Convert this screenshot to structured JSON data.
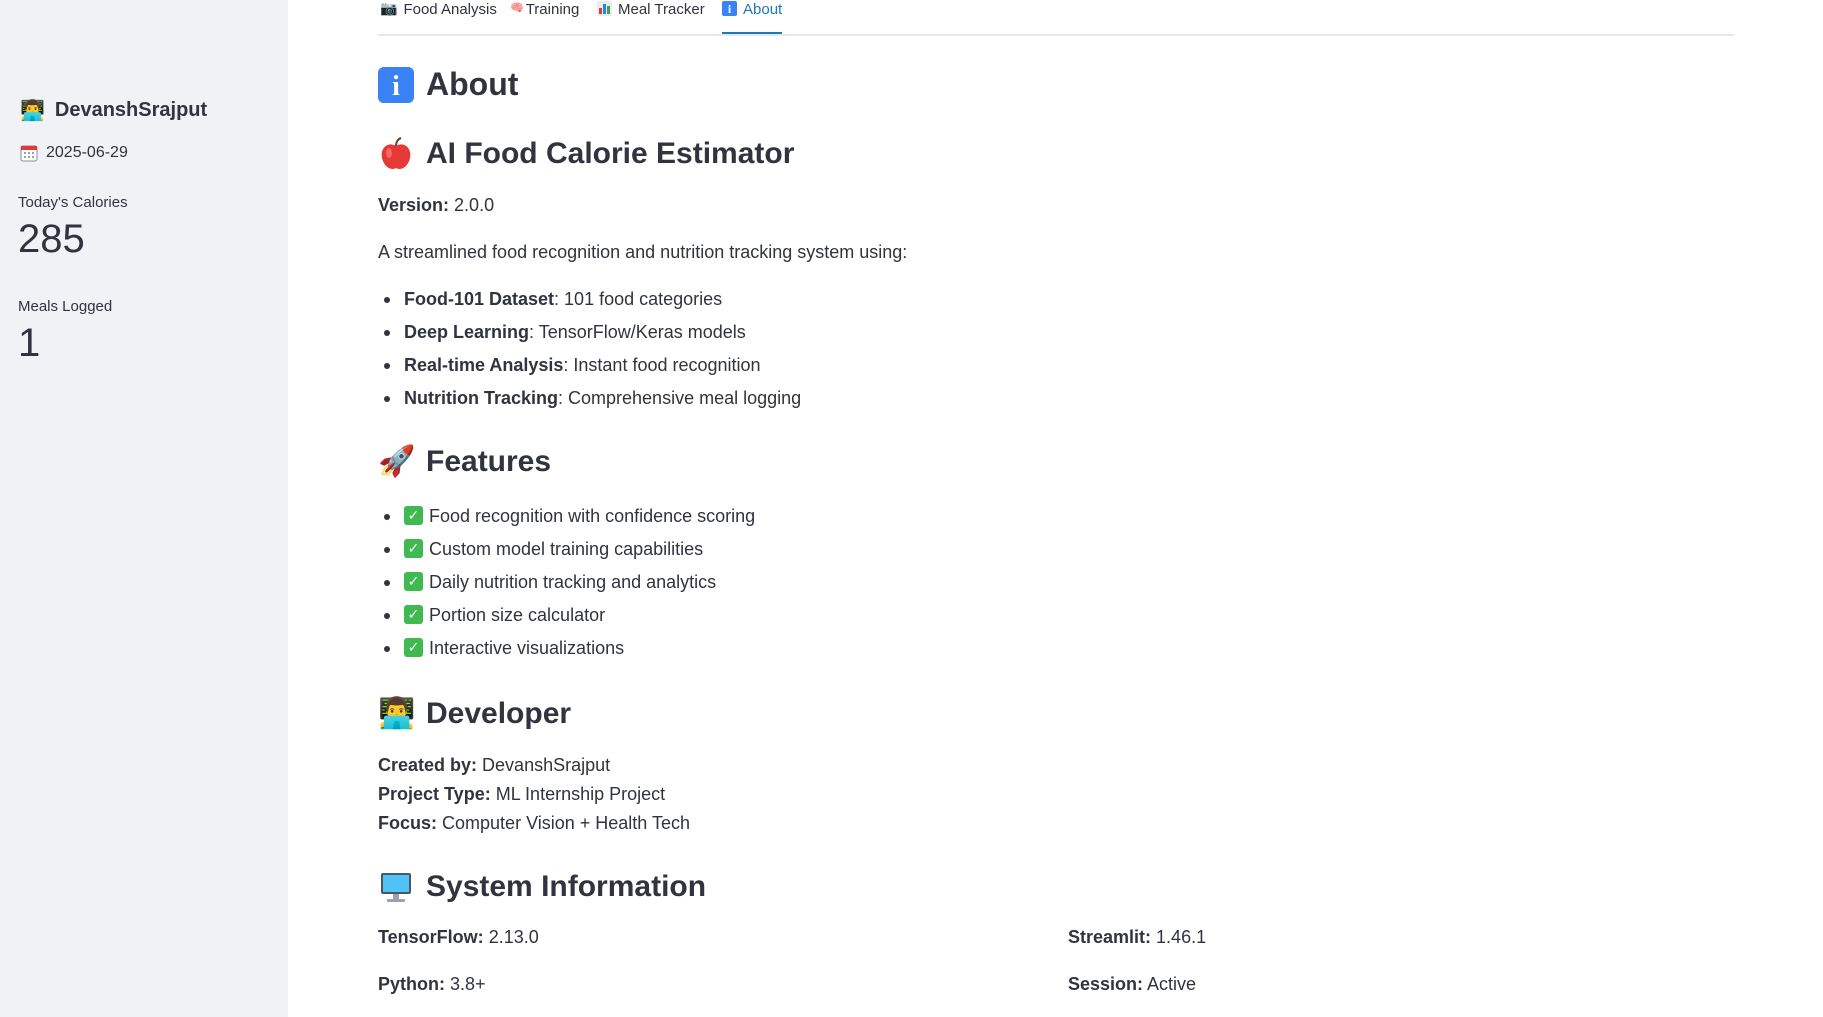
{
  "sidebar": {
    "username": "DevanshSrajput",
    "user_icon": "developer-icon",
    "date": "2025-06-29",
    "date_icon": "calendar-icon",
    "metrics": [
      {
        "label": "Today's Calories",
        "value": "285"
      },
      {
        "label": "Meals Logged",
        "value": "1"
      }
    ]
  },
  "tabs": [
    {
      "label": "Food Analysis",
      "icon": "camera-icon"
    },
    {
      "label": "Training",
      "icon": "brain-icon"
    },
    {
      "label": "Meal Tracker",
      "icon": "bar-chart-icon"
    },
    {
      "label": "About",
      "icon": "info-icon",
      "active": true
    }
  ],
  "content": {
    "about_title": "About",
    "app_title": "AI Food Calorie Estimator",
    "version_label": "Version:",
    "version_value": "2.0.0",
    "intro": "A streamlined food recognition and nutrition tracking system using:",
    "tech_items": [
      {
        "bold": "Food-101 Dataset",
        "text": ": 101 food categories"
      },
      {
        "bold": "Deep Learning",
        "text": ": TensorFlow/Keras models"
      },
      {
        "bold": "Real-time Analysis",
        "text": ": Instant food recognition"
      },
      {
        "bold": "Nutrition Tracking",
        "text": ": Comprehensive meal logging"
      }
    ],
    "features_title": "Features",
    "features": [
      "Food recognition with confidence scoring",
      "Custom model training capabilities",
      "Daily nutrition tracking and analytics",
      "Portion size calculator",
      "Interactive visualizations"
    ],
    "developer_title": "Developer",
    "developer": [
      {
        "label": "Created by:",
        "value": "DevanshSrajput"
      },
      {
        "label": "Project Type:",
        "value": "ML Internship Project"
      },
      {
        "label": "Focus:",
        "value": "Computer Vision + Health Tech"
      }
    ],
    "system_title": "System Information",
    "system": [
      {
        "label": "TensorFlow:",
        "value": "2.13.0"
      },
      {
        "label": "Streamlit:",
        "value": "1.46.1"
      },
      {
        "label": "Python:",
        "value": "3.8+"
      },
      {
        "label": "Session:",
        "value": "Active"
      }
    ]
  },
  "colors": {
    "accent": "#1f77b4",
    "sidebar_bg": "#f0f2f6",
    "check_green": "#3fb950",
    "info_blue": "#3b82f6"
  }
}
